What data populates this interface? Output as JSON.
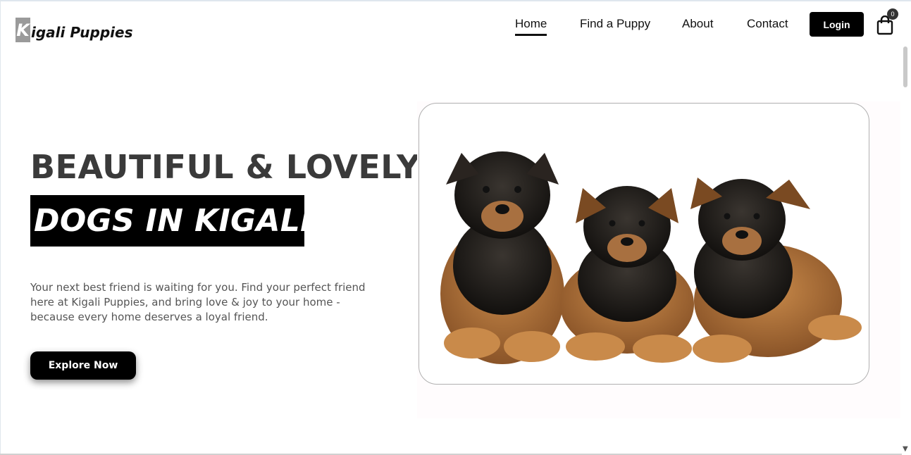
{
  "brand": {
    "logo_initial": "K",
    "logo_rest": "igali Puppies"
  },
  "nav": {
    "items": [
      {
        "label": "Home",
        "active": true
      },
      {
        "label": "Find a Puppy",
        "active": false
      },
      {
        "label": "About",
        "active": false
      },
      {
        "label": "Contact",
        "active": false
      }
    ],
    "login_label": "Login",
    "cart_count": "0"
  },
  "hero": {
    "headline_line1": "BEAUTIFUL & LOVELY",
    "headline_line2": "DOGS IN KIGALI.",
    "intro": "Your next best friend is waiting for you. Find your perfect friend here at Kigali Puppies, and bring love & joy to your home - because every home deserves a loyal friend.",
    "cta_label": "Explore Now",
    "image_subject": "three german shepherd puppies"
  },
  "colors": {
    "primary": "#000000",
    "heading": "#3a3a3a",
    "text": "#555555",
    "logo_box": "#9a9a9a"
  }
}
